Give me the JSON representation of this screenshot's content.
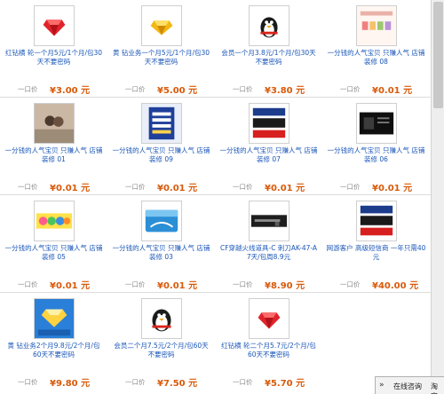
{
  "price_label": "一口价",
  "items": [
    {
      "icon": "red-diamond-icon",
      "title": "红钻横 轮一个月5元/1个月/包30天不要密码",
      "price": "¥3.00 元"
    },
    {
      "icon": "yellow-diamond-icon",
      "title": "黄 钻业务一个月5元/1个月/包30天不要密码",
      "price": "¥5.00 元"
    },
    {
      "icon": "qq-penguin-icon",
      "title": "会员一个月3.8元/1个月/包30天不要密码",
      "price": "¥3.80 元"
    },
    {
      "icon": "store-banner-icon",
      "title": "一分钱的人气宝贝 只赚人气 店铺装修 08",
      "price": "¥0.01 元"
    },
    {
      "icon": "couple-photo-icon",
      "title": "一分钱的人气宝贝 只赚人气 店铺装修 01",
      "price": "¥0.01 元"
    },
    {
      "icon": "price-list-card-icon",
      "title": "一分钱的人气宝贝 只赚人气 店铺装修 09",
      "price": "¥0.01 元"
    },
    {
      "icon": "agent-banner-icon",
      "title": "一分钱的人气宝贝 只赚人气 店铺装修 07",
      "price": "¥0.01 元"
    },
    {
      "icon": "dark-screen-icon",
      "title": "一分钱的人气宝贝 只赚人气 店铺装修 06",
      "price": "¥0.01 元"
    },
    {
      "icon": "welcome-banner-icon",
      "title": "一分钱的人气宝贝 只赚人气 店铺装修 05",
      "price": "¥0.01 元"
    },
    {
      "icon": "blue-card-icon",
      "title": "一分钱的人气宝贝 只赚人气 店铺装修 03",
      "price": "¥0.01 元"
    },
    {
      "icon": "game-weapon-icon",
      "title": "CF穿越火线道具-C 刺刀AK-47-A 7天/包周8.9元",
      "price": "¥8.90 元"
    },
    {
      "icon": "agent-banner-icon",
      "title": "网游客户 高级短信商 一年只需40元",
      "price": "¥40.00 元"
    },
    {
      "icon": "qq-shop-diamond-icon",
      "title": "黄 钻业务2个月9.8元/2个月/包60天不要密码",
      "price": "¥9.80 元"
    },
    {
      "icon": "qq-penguin-icon",
      "title": "会员二个月7.5元/2个月/包60天不要密码",
      "price": "¥7.50 元"
    },
    {
      "icon": "red-diamond-icon",
      "title": "红钻横 轮二个月5.7元/2个月/包60天不要密码",
      "price": "¥5.70 元"
    }
  ],
  "footer": {
    "arrow": "»",
    "link1": "在线咨询",
    "link2": "淘宝"
  }
}
